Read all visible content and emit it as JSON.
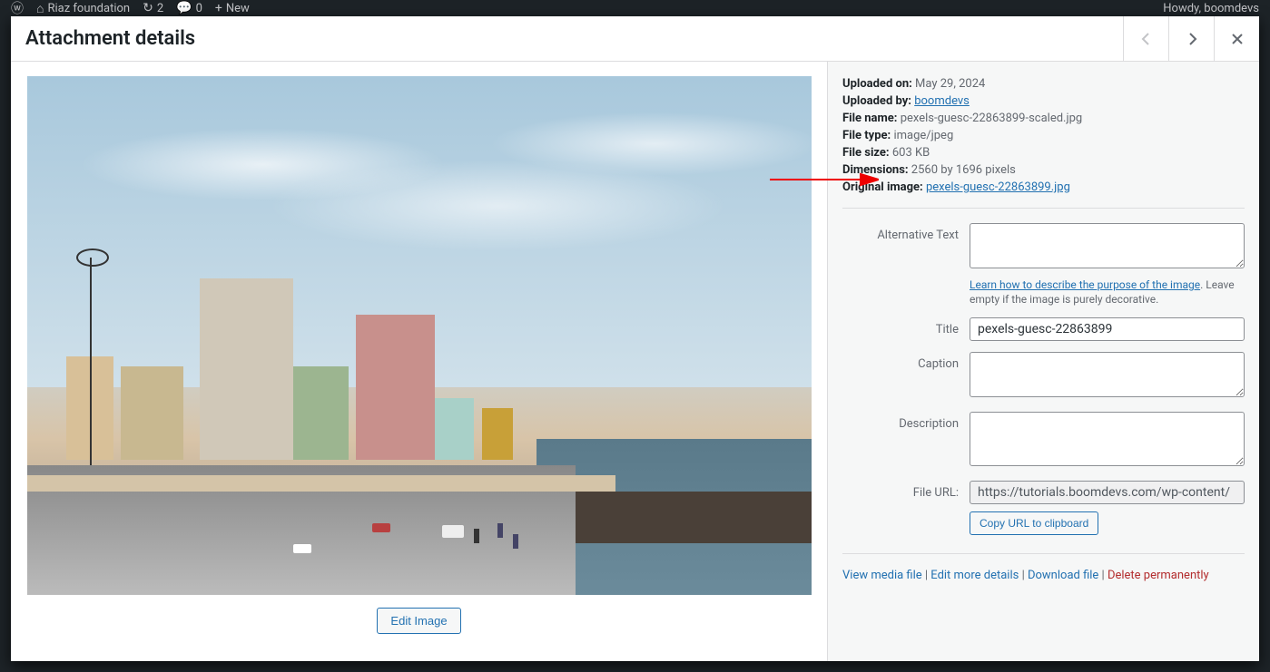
{
  "admin_bar": {
    "site_name": "Riaz foundation",
    "updates": "2",
    "comments": "0",
    "new": "New",
    "howdy": "Howdy, boomdevs"
  },
  "modal": {
    "title": "Attachment details"
  },
  "meta": {
    "uploaded_on_label": "Uploaded on:",
    "uploaded_on": "May 29, 2024",
    "uploaded_by_label": "Uploaded by:",
    "uploaded_by": "boomdevs",
    "file_name_label": "File name:",
    "file_name": "pexels-guesc-22863899-scaled.jpg",
    "file_type_label": "File type:",
    "file_type": "image/jpeg",
    "file_size_label": "File size:",
    "file_size": "603 KB",
    "dimensions_label": "Dimensions:",
    "dimensions": "2560 by 1696 pixels",
    "original_label": "Original image:",
    "original_link": "pexels-guesc-22863899.jpg"
  },
  "form": {
    "alt_label": "Alternative Text",
    "alt_value": "",
    "alt_help_link": "Learn how to describe the purpose of the image",
    "alt_help_rest": ". Leave empty if the image is purely decorative.",
    "title_label": "Title",
    "title_value": "pexels-guesc-22863899",
    "caption_label": "Caption",
    "caption_value": "",
    "description_label": "Description",
    "description_value": "",
    "fileurl_label": "File URL:",
    "fileurl_value": "https://tutorials.boomdevs.com/wp-content/",
    "copy_btn": "Copy URL to clipboard"
  },
  "edit_image": "Edit Image",
  "actions": {
    "view": "View media file",
    "edit": "Edit more details",
    "download": "Download file",
    "delete": "Delete permanently",
    "sep": " | "
  }
}
